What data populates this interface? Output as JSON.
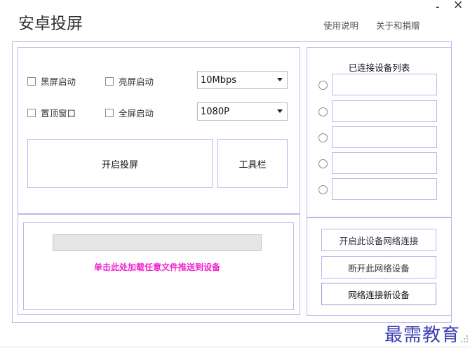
{
  "app": {
    "title": "安卓投屏"
  },
  "header": {
    "usage_link": "使用说明",
    "about_link": "关于和捐赠"
  },
  "window_controls": {
    "minimize": "-",
    "close": "×"
  },
  "options": {
    "black_screen_start": "黑屏启动",
    "bright_screen_start": "亮屏启动",
    "always_on_top": "置顶窗口",
    "fullscreen_start": "全屏启动"
  },
  "bitrate": {
    "value": "10Mbps"
  },
  "resolution": {
    "value": "1080P"
  },
  "actions": {
    "start_mirroring": "开启投屏",
    "toolbar": "工具栏"
  },
  "file_push": {
    "prompt": "单击此处加载任意文件推送到设备"
  },
  "device_list": {
    "title": "已连接设备列表"
  },
  "network": {
    "enable_network": "开启此设备网络连接",
    "disconnect_network": "断开此网络设备",
    "connect_new": "网络连接新设备"
  },
  "watermark": {
    "text": "最需教育"
  }
}
